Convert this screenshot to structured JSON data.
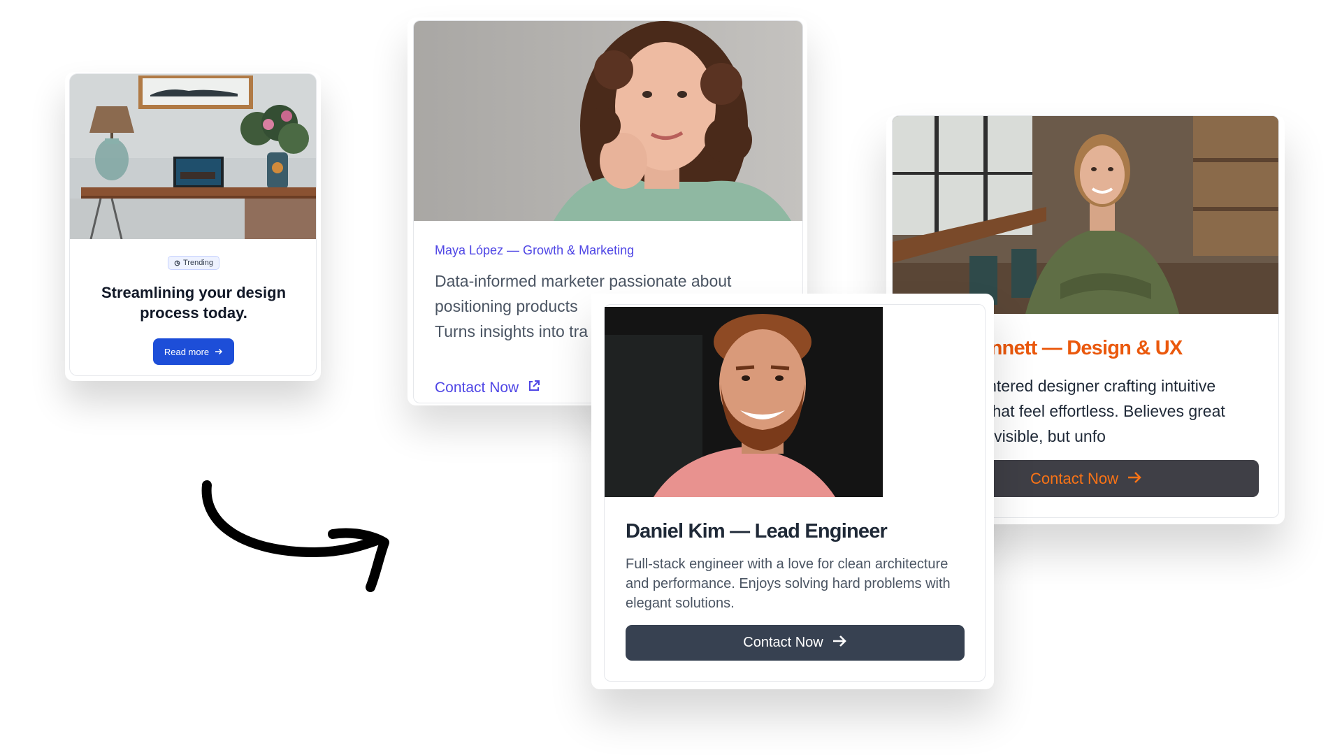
{
  "blog_card": {
    "badge": "Trending",
    "headline": "Streamlining your design process today.",
    "button_label": "Read more",
    "accent": "#1d4ed8"
  },
  "maya_card": {
    "role": "Maya López — Growth & Marketing",
    "description": "Data-informed marketer passionate about positioning products",
    "description_tail": "Turns insights into tra",
    "contact_label": "Contact Now",
    "contact_icon": "external-link-icon",
    "accent": "#4f46e5"
  },
  "daniel_card": {
    "name": "Daniel Kim — Lead Engineer",
    "description": "Full-stack engineer with a love for clean architecture and performance. Enjoys solving hard problems with elegant solutions.",
    "button_label": "Contact Now",
    "button_icon": "arrow-right-icon",
    "button_color": "#374151"
  },
  "sofia_card": {
    "name": "Sofia Bennett — Design & UX",
    "description": "Human-centered designer crafting intuitive interfaces that feel effortless. Believes great design is invisible, but unfo",
    "button_label": "Contact Now",
    "button_icon": "arrow-right-icon",
    "accent": "#ea580c",
    "button_color": "#3f3f46"
  }
}
